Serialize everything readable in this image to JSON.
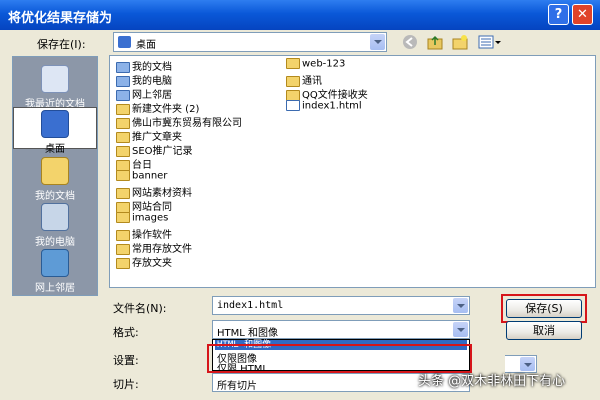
{
  "window": {
    "title": "将优化结果存储为",
    "help_label": "?",
    "close_label": "✕"
  },
  "toolbar": {
    "save_in_label": "保存在(I):",
    "location": "桌面"
  },
  "places": [
    {
      "label": "我最近的文档",
      "icon": "recent-docs-icon"
    },
    {
      "label": "桌面",
      "icon": "desktop-icon"
    },
    {
      "label": "我的文档",
      "icon": "my-documents-icon"
    },
    {
      "label": "我的电脑",
      "icon": "my-computer-icon"
    },
    {
      "label": "网上邻居",
      "icon": "network-icon"
    }
  ],
  "files_col1": [
    "我的文档",
    "我的电脑",
    "网上邻居",
    "新建文件夹 (2)",
    "佛山市冀东贸易有限公司",
    "推广文章夹",
    "SEO推广记录",
    "台日",
    "banner",
    "网站素材资料",
    "网站合同",
    "images",
    "操作软件",
    "常用存放文件",
    "存放文夹"
  ],
  "files_col2": [
    "web-123",
    "通讯",
    "QQ文件接收夹",
    "index1.html"
  ],
  "form": {
    "filename_label": "文件名(N):",
    "filename_value": "index1.html",
    "format_label": "格式:",
    "format_value": "HTML 和图像",
    "settings_label": "设置:",
    "slices_label": "切片:",
    "slices_value": "所有切片",
    "save_button": "保存(S)",
    "cancel_button": "取消"
  },
  "format_options": [
    "HTML 和图像",
    "仅限图像",
    "仅限 HTML"
  ],
  "watermark": "头条 @双木非林田下有心",
  "colors": {
    "title_bar": "#0A58D8",
    "highlight_red": "#D6151A",
    "dialog_bg": "#ECE9D8"
  }
}
